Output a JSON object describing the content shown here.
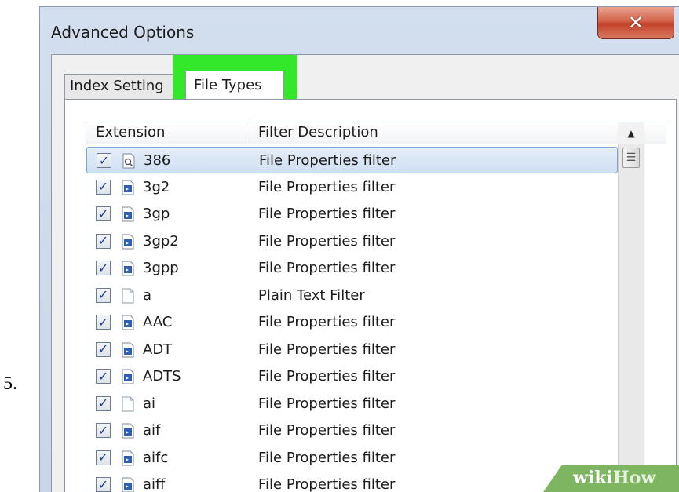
{
  "step_label": "5.",
  "dialog": {
    "title": "Advanced Options",
    "close_glyph": "✕"
  },
  "tabs": [
    {
      "label": "Index Setting",
      "selected": false
    },
    {
      "label": "File Types",
      "selected": true
    }
  ],
  "highlight_color": "#33e82a",
  "columns": {
    "extension": "Extension",
    "description": "Filter Description"
  },
  "rows": [
    {
      "ext": "386",
      "desc": "File Properties filter",
      "icon": "search-file-icon",
      "checked": true,
      "selected": true
    },
    {
      "ext": "3g2",
      "desc": "File Properties filter",
      "icon": "media-file-icon",
      "checked": true,
      "selected": false
    },
    {
      "ext": "3gp",
      "desc": "File Properties filter",
      "icon": "media-file-icon",
      "checked": true,
      "selected": false
    },
    {
      "ext": "3gp2",
      "desc": "File Properties filter",
      "icon": "media-file-icon",
      "checked": true,
      "selected": false
    },
    {
      "ext": "3gpp",
      "desc": "File Properties filter",
      "icon": "media-file-icon",
      "checked": true,
      "selected": false
    },
    {
      "ext": "a",
      "desc": "Plain Text Filter",
      "icon": "blank-file-icon",
      "checked": true,
      "selected": false
    },
    {
      "ext": "AAC",
      "desc": "File Properties filter",
      "icon": "media-file-icon",
      "checked": true,
      "selected": false
    },
    {
      "ext": "ADT",
      "desc": "File Properties filter",
      "icon": "media-file-icon",
      "checked": true,
      "selected": false
    },
    {
      "ext": "ADTS",
      "desc": "File Properties filter",
      "icon": "media-file-icon",
      "checked": true,
      "selected": false
    },
    {
      "ext": "ai",
      "desc": "File Properties filter",
      "icon": "blank-file-icon",
      "checked": true,
      "selected": false
    },
    {
      "ext": "aif",
      "desc": "File Properties filter",
      "icon": "media-file-icon",
      "checked": true,
      "selected": false
    },
    {
      "ext": "aifc",
      "desc": "File Properties filter",
      "icon": "media-file-icon",
      "checked": true,
      "selected": false
    },
    {
      "ext": "aiff",
      "desc": "File Properties filter",
      "icon": "media-file-icon",
      "checked": true,
      "selected": false
    }
  ],
  "scrollbar": {
    "up_glyph": "▲",
    "thumb_glyph": "☰"
  },
  "watermark": {
    "wiki": "wiki",
    "how": "How"
  }
}
